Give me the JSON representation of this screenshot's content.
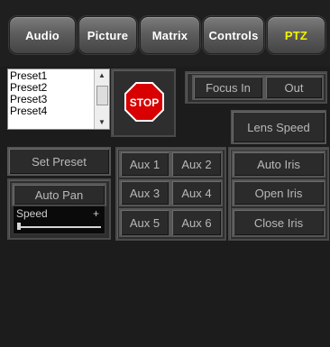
{
  "tabs": [
    {
      "label": "Audio"
    },
    {
      "label": "Picture"
    },
    {
      "label": "Matrix"
    },
    {
      "label": "Controls"
    },
    {
      "label": "PTZ",
      "active": true
    }
  ],
  "presets": {
    "items": [
      "Preset1",
      "Preset2",
      "Preset3",
      "Preset4"
    ]
  },
  "stop": {
    "label": "STOP"
  },
  "focus": {
    "in_label": "Focus In",
    "out_label": "Out"
  },
  "lens_speed": {
    "label": "Lens Speed"
  },
  "set_preset": {
    "label": "Set Preset"
  },
  "auto_pan": {
    "label": "Auto Pan"
  },
  "speed": {
    "label": "Speed",
    "plus": "+"
  },
  "aux": {
    "labels": [
      "Aux 1",
      "Aux 2",
      "Aux 3",
      "Aux 4",
      "Aux 5",
      "Aux 6"
    ]
  },
  "iris": {
    "auto_label": "Auto Iris",
    "open_label": "Open Iris",
    "close_label": "Close Iris"
  },
  "colors": {
    "active_tab_text": "#f3f500",
    "stop_red": "#d80000"
  }
}
